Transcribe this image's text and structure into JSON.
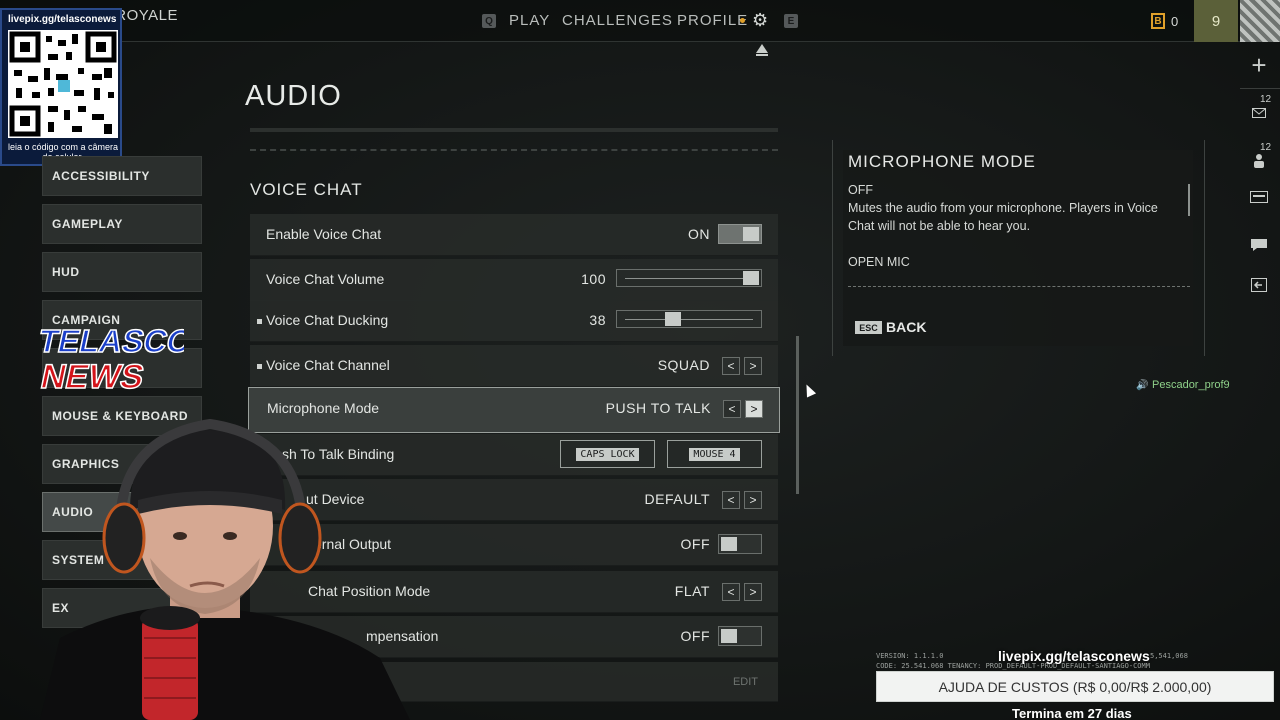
{
  "topbar": {
    "mode_title": "BATTLE ROYALE",
    "left_key": "Q",
    "right_key": "E",
    "nav": [
      "PLAY",
      "CHALLENGES",
      "PROFILE"
    ],
    "currency_icon": "B",
    "currency_count": "0",
    "level": "9"
  },
  "side_panel": {
    "mail_count": "12",
    "friends_count": "12"
  },
  "qr_overlay": {
    "url": "livepix.gg/telasconews",
    "caption": "leia o código com a câmera do celular."
  },
  "page_title": "AUDIO",
  "menu": {
    "items": [
      "ACCESSIBILITY",
      "GAMEPLAY",
      "HUD",
      "CAMPAIGN",
      "MOUSE & KEYBOARD",
      "GRAPHICS",
      "AUDIO",
      "SYSTEM",
      "EX"
    ],
    "active": "AUDIO"
  },
  "section_title": "VOICE CHAT",
  "settings": {
    "enable_voice_chat": {
      "label": "Enable Voice Chat",
      "value": "ON"
    },
    "voice_chat_volume": {
      "label": "Voice Chat Volume",
      "value": "100",
      "level": 1.0
    },
    "voice_chat_ducking": {
      "label": "Voice Chat Ducking",
      "value": "38",
      "level": 0.38
    },
    "voice_chat_channel": {
      "label": "Voice Chat Channel",
      "value": "SQUAD"
    },
    "microphone_mode": {
      "label": "Microphone Mode",
      "value": "PUSH TO TALK"
    },
    "push_to_talk_binding": {
      "label": "sh To Talk Binding",
      "primary": "CAPS LOCK",
      "secondary": "MOUSE 4"
    },
    "input_device": {
      "label": "ut Device",
      "value": "DEFAULT"
    },
    "external_output": {
      "label": "ernal Output",
      "value": "OFF"
    },
    "position_mode": {
      "label": "Chat Position Mode",
      "value": "FLAT"
    },
    "compensation": {
      "label": "mpensation",
      "value": "OFF"
    },
    "edit_label": "EDIT"
  },
  "description": {
    "title": "MICROPHONE MODE",
    "option1": "OFF",
    "option1_text": "Mutes the audio from your microphone. Players in Voice Chat will not be able to hear you.",
    "option2": "OPEN MIC",
    "esc_key": "ESC",
    "back_label": "BACK"
  },
  "player_tag": "Pescador_prof9",
  "footer": {
    "version_line1": "VERSION: 1.1.1.0",
    "version_line2": "CODE: 25.541.068   TENANCY: PROD_DEFAULT-PROD_DEFAULT-SANTIAGO-COMM",
    "version_number": "5,541,068",
    "livepix": "livepix.gg/telasconews",
    "donation": "AJUDA DE CUSTOS (R$ 0,00/R$ 2.000,00)",
    "donation_sub": "Termina em 27 dias"
  },
  "logo": {
    "line1": "TELASCO",
    "line2": "NEWS"
  },
  "colors": {
    "accent": "#e0a02a",
    "panel": "#2b2f2d",
    "highlight": "#9aa09c",
    "player_tag": "#8fd18a"
  }
}
